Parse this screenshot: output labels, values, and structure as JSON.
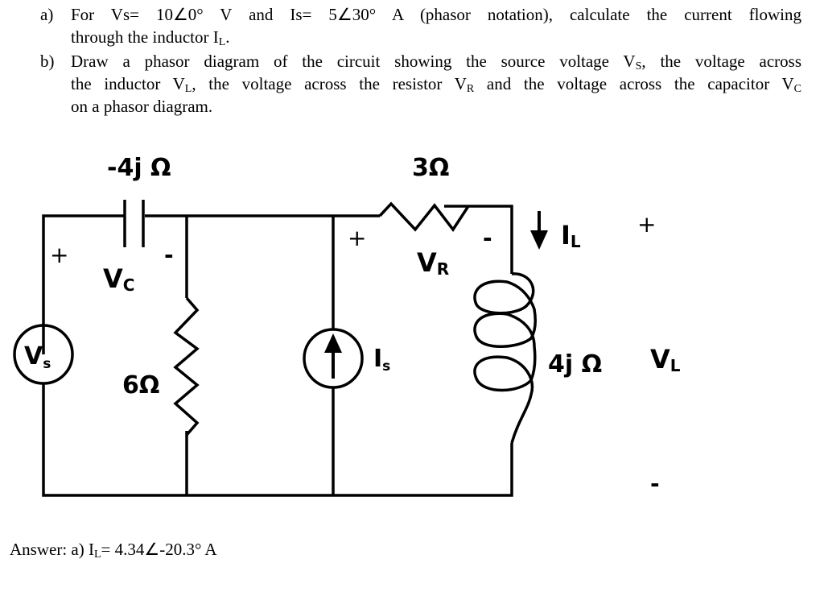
{
  "question": {
    "a": {
      "label": "a)",
      "line1": "For Vs= 10∠0° V and Is= 5∠30° A (phasor notation), calculate the current flowing",
      "line2_pre": "through the inductor I",
      "line2_sub": "L",
      "line2_post": "."
    },
    "b": {
      "label": "b)",
      "line1_pre": "Draw a phasor diagram of the circuit showing the source voltage V",
      "line1_sub": "S",
      "line1_post": ", the voltage across",
      "line2_pre": "the inductor V",
      "line2_sub": "L",
      "line2_mid1": ", the voltage across the resistor V",
      "line2_sub2": "R",
      "line2_mid2": " and the voltage across the capacitor V",
      "line2_sub3": "C",
      "line3": "on a phasor diagram."
    }
  },
  "circuit": {
    "capacitor": {
      "impedance": "-4j Ω",
      "voltage": "V",
      "voltage_sub": "C",
      "plus": "+",
      "minus": "-"
    },
    "resistor_series": {
      "impedance": "3Ω",
      "voltage": "V",
      "voltage_sub": "R",
      "plus": "+",
      "minus": "-"
    },
    "resistor_shunt": {
      "impedance": "6Ω"
    },
    "voltage_source": {
      "label": "V",
      "label_sub": "s"
    },
    "current_source": {
      "label": "I",
      "label_sub": "s"
    },
    "inductor": {
      "impedance": "4j Ω",
      "current": "I",
      "current_sub": "L",
      "voltage": "V",
      "voltage_sub": "L",
      "plus": "+",
      "minus": "-"
    }
  },
  "answer": {
    "pre": "Answer: a) I",
    "sub": "L",
    "post": "= 4.34∠-20.3° A"
  }
}
